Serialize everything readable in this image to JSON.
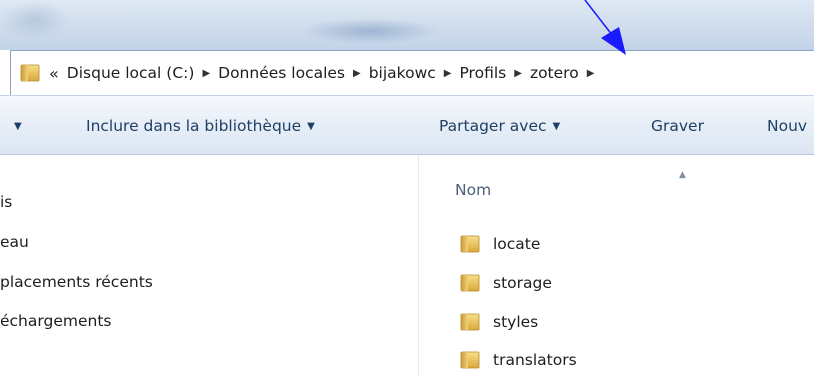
{
  "addressbar": {
    "overflow_label": "«",
    "crumbs": [
      "Disque local (C:)",
      "Données locales",
      "bijakowc",
      "Profils",
      "zotero"
    ],
    "icon": "folder-icon"
  },
  "toolbar": {
    "items": [
      "Inclure dans la bibliothèque",
      "Partager avec",
      "Graver",
      "Nouv"
    ]
  },
  "nav_pane": {
    "items": [
      "is",
      "eau",
      "placements récents",
      "échargements"
    ]
  },
  "content": {
    "column_header": "Nom",
    "files": [
      "locate",
      "storage",
      "styles",
      "translators"
    ],
    "file_icon": "folder-icon"
  },
  "colors": {
    "annotation_arrow": "#1a1aff",
    "folder_yellow": "#e8c04c",
    "toolbar_text": "#1e3f66"
  }
}
